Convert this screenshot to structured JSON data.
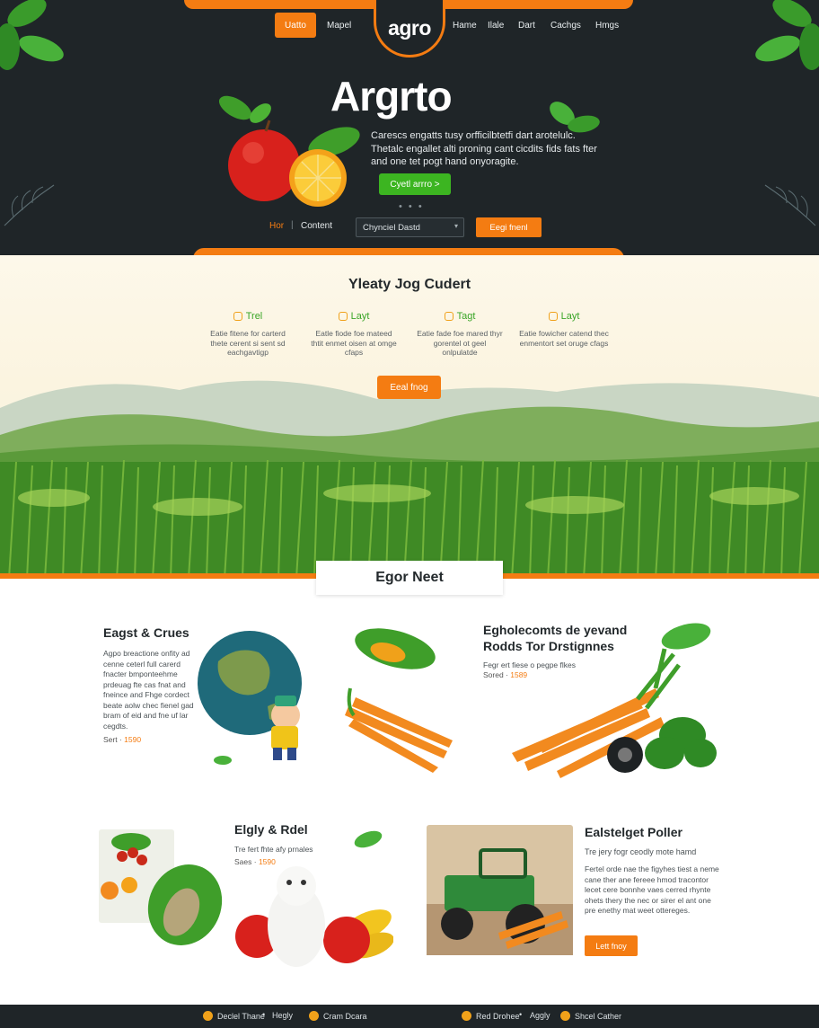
{
  "nav": {
    "left": [
      "Uatto",
      "Mapel"
    ],
    "logo": "agro",
    "right": [
      "Hame",
      "Ilale",
      "Dart",
      "Cachgs",
      "Hmgs"
    ]
  },
  "hero": {
    "title": "Argrto",
    "description": "Carescs engatts tusy orfficilbtetfi dart arotelulc. Thetalc engallet alti proning cant cicdits fids fats fter and one tet pogt hand onyoragite.",
    "cta": "Cyetl arrro >",
    "dots": "• • •",
    "filter_hot": "Hor",
    "filter_sep": "|",
    "filter_content": "Content",
    "select_value": "Chynciel Dastd",
    "search_button": "Eegi fnenl"
  },
  "features": {
    "title": "Yleaty Jog Cudert",
    "items": [
      {
        "title": "Trel",
        "text": "Eatie fitene for carterd thete cerent si sent sd eachgavtigp"
      },
      {
        "title": "Layt",
        "text": "Eatle fiode foe mateed thtit enmet oisen at omge cfaps"
      },
      {
        "title": "Tagt",
        "text": "Eatie fade foe mared thyr gorentel ot geel onlpulatde"
      },
      {
        "title": "Layt",
        "text": "Eatie fowicher catend thec enmentort set oruge cfags"
      }
    ],
    "button": "Eeal fnog"
  },
  "section_tab": "Egor Neet",
  "products": {
    "p1": {
      "title": "Eagst & Crues",
      "text": "Agpo breactione onfity ad cenne ceterl full carerd fnacter bmponteehme prdeuag fte cas fnat and fneince and Fhge cordect beate aolw chec fienel gad bram of eid and fne uf lar cegdts.",
      "price_label": "Sert",
      "price": "1590"
    },
    "p2": {
      "title": "Egholecomts de yevand Rodds Tor Drstignnes",
      "text": "Fegr ert fiese o pegpe flkes",
      "price_label": "Sored",
      "price": "1589"
    },
    "p3": {
      "title": "Elgly & Rdel",
      "text": "Tre fert fhte afy prnales",
      "price_label": "Saes",
      "price": "1590"
    },
    "p4": {
      "title": "Ealstelget Poller",
      "subtitle": "Tre jery fogr ceodly mote hamd",
      "text": "Fertel orde nae the figyhes tiest a neme cane ther ane fereee hmod tracontor lecet cere bonnhe vaes cerred rhynte ohets thery the nec or sirer el ant one pre enethy mat weet ottereges.",
      "button": "Lett fnoy"
    }
  },
  "footer": [
    {
      "label": "Declel Thane",
      "sub": "Hegly"
    },
    {
      "label": "Cram Dcara",
      "sub": ""
    },
    {
      "label": "Red Drohee",
      "sub": "Aggly"
    },
    {
      "label": "Shcel Cather",
      "sub": ""
    }
  ]
}
